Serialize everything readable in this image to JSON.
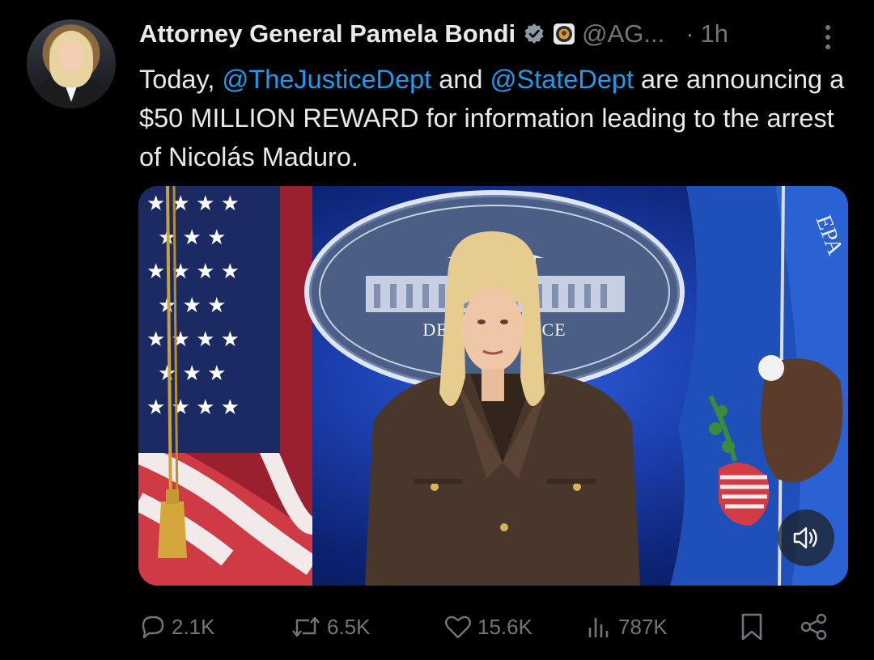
{
  "author": {
    "name": "Attorney General Pamela Bondi",
    "handle": "@AG...",
    "separator": "·",
    "time": "1h",
    "verified_icon": "verified-badge-icon",
    "affiliation_icon": "doj-seal-icon"
  },
  "tweet": {
    "text_prefix": "Today, ",
    "mention_1": "@TheJusticeDept",
    "text_mid": " and ",
    "mention_2": "@StateDept",
    "text_suffix": " are announcing a $50 MILLION REWARD for information leading to the arrest of Nicolás Maduro."
  },
  "media": {
    "seal_text": "DEPART         USTICE",
    "mute_icon": "volume-icon"
  },
  "actions": {
    "replies": "2.1K",
    "reposts": "6.5K",
    "likes": "15.6K",
    "views": "787K"
  },
  "colors": {
    "background": "#000000",
    "text": "#e7e9ea",
    "secondary": "#71767b",
    "link": "#1d9bf0"
  }
}
